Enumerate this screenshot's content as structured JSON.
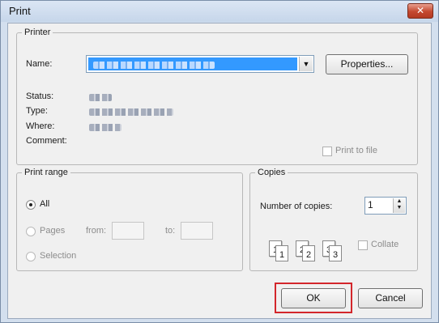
{
  "window": {
    "title": "Print",
    "close_label": "✕"
  },
  "printer": {
    "legend": "Printer",
    "name_label": "Name:",
    "properties_label": "Properties...",
    "status_label": "Status:",
    "type_label": "Type:",
    "where_label": "Where:",
    "comment_label": "Comment:",
    "print_to_file_label": "Print to file",
    "combo_arrow": "▼"
  },
  "print_range": {
    "legend": "Print range",
    "all_label": "All",
    "pages_label": "Pages",
    "from_label": "from:",
    "to_label": "to:",
    "selection_label": "Selection",
    "selected": "All"
  },
  "copies": {
    "legend": "Copies",
    "number_label": "Number of copies:",
    "number_value": "1",
    "collate_label": "Collate",
    "collate_checked": false,
    "spin_up": "▲",
    "spin_down": "▼",
    "page_icons": [
      {
        "back": "1",
        "front": "1"
      },
      {
        "back": "2",
        "front": "2"
      },
      {
        "back": "3",
        "front": "3"
      }
    ]
  },
  "buttons": {
    "ok_label": "OK",
    "cancel_label": "Cancel"
  },
  "colors": {
    "highlight": "#d3262b",
    "selection": "#3399ff"
  }
}
